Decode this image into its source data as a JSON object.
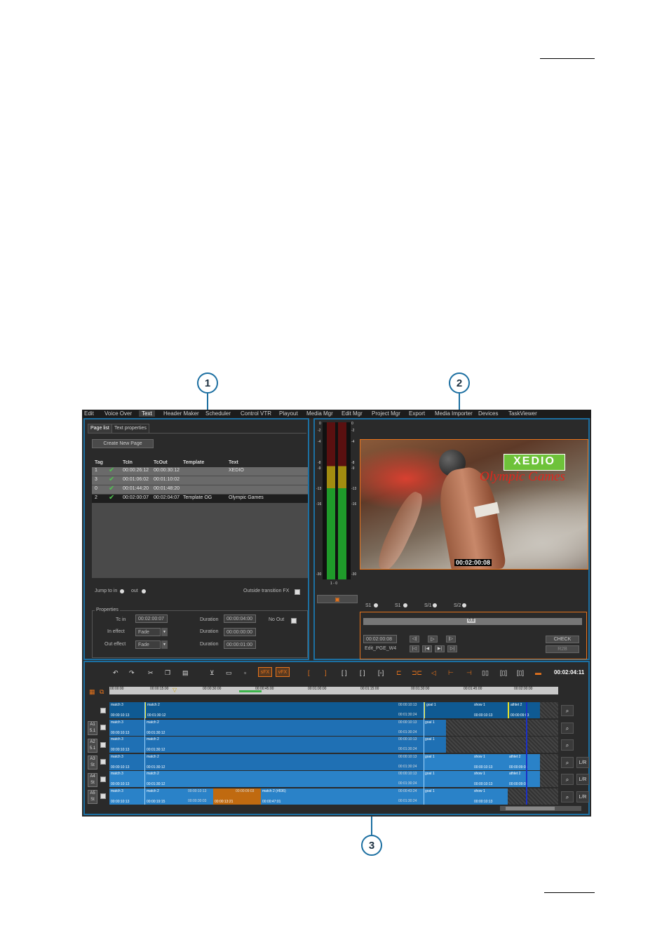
{
  "callouts": {
    "c1": "1",
    "c2": "2",
    "c3": "3"
  },
  "menu": [
    "Edit",
    "Voice Over",
    "Text",
    "Header Maker",
    "Scheduler",
    "Control VTR",
    "Playout",
    "Media Mgr",
    "Edit Mgr",
    "Project Mgr",
    "Export",
    "Media Importer",
    "Devices",
    "TaskViewer"
  ],
  "text_panel": {
    "tabs": [
      "Page list",
      "Text properties"
    ],
    "create_button": "Create New Page",
    "headers": [
      "Tag",
      "TcIn",
      "TcOut",
      "Template",
      "Text"
    ],
    "rows": [
      {
        "tag": "1",
        "tcin": "00:00:26:12",
        "tcout": "00:00:30:12",
        "template": "",
        "text": "XEDIO"
      },
      {
        "tag": "3",
        "tcin": "00:01:06:02",
        "tcout": "00:01:10:02",
        "template": "",
        "text": ""
      },
      {
        "tag": "0",
        "tcin": "00:01:44:20",
        "tcout": "00:01:48:20",
        "template": "",
        "text": ""
      },
      {
        "tag": "2",
        "tcin": "00:02:00:07",
        "tcout": "00:02:04:07",
        "template": "Template OG",
        "text": "Olympic Games"
      }
    ],
    "jump_to_in": "Jump to in",
    "out": "out",
    "outside_fx": "Outside transition FX",
    "properties": "Properties",
    "tc_in_label": "Tc in",
    "tc_in_value": "00:02:00:07",
    "duration_label": "Duration",
    "duration_values": [
      "00:00:04:00",
      "00:00:00:00",
      "00:00:01:00"
    ],
    "no_out": "No Out",
    "in_effect_label": "In effect",
    "out_effect_label": "Out effect",
    "in_effect_value": "Fade",
    "out_effect_value": "Fade"
  },
  "viewer": {
    "meter_scale_left": [
      "0",
      "-2",
      "-4",
      "-8",
      "-9",
      "-13",
      "-16",
      "-30"
    ],
    "meter_scale_right": [
      "0",
      "-2",
      "-4",
      "-8",
      "-9",
      "-13",
      "-16",
      "-30"
    ],
    "meter_channel": "1 - 0",
    "logo": "XEDIO",
    "overlay_text": "Olympic Games",
    "video_timecode": "00:02:00:08",
    "channels": [
      "S1",
      "S1",
      "S/1",
      "S/2"
    ],
    "transport_timecode": "00:02:00:08",
    "clip_name": "Edit_PGE_W4",
    "check": "CHECK",
    "r2b": "R2B",
    "progress_label": "0.0"
  },
  "timeline": {
    "total_timecode": "00:02:04:11",
    "ruler": [
      "00:00:00",
      "00:00:15:00",
      "00:00:30:00",
      "00:00:45:00",
      "00:01:00:00",
      "00:01:15:00",
      "00:01:30:00",
      "00:01:45:00",
      "00:02:00:00"
    ],
    "tracks": [
      {
        "label_top": "",
        "label_bottom": ""
      },
      {
        "label_top": "A1",
        "label_bottom": "5.1"
      },
      {
        "label_top": "A2",
        "label_bottom": "5.1"
      },
      {
        "label_top": "A3",
        "label_bottom": "St"
      },
      {
        "label_top": "A4",
        "label_bottom": "St"
      },
      {
        "label_top": "A5",
        "label_bottom": "St"
      }
    ],
    "clip_names": {
      "c1": "match 3",
      "c2": "match 2",
      "c3": "goal 1",
      "c4": "show 1",
      "c5": "athlet 2",
      "c6": "match 2 (#836)"
    },
    "clip_times": {
      "c1": "00:00:10:13",
      "c2": "00:01:30:12",
      "c3": "00:00:10:13",
      "c4": "00:01:30:24",
      "c5": "00:00:10:13",
      "c6": "00:00:09:03",
      "c7": "00:00:19:15",
      "c8": "00:00:30:03",
      "c9": "00:00:13:21",
      "c10": "00:00:47:01",
      "c11": "00:00:43:24"
    },
    "lr": "L/R",
    "sfx": "sFX",
    "vfx": "vFX"
  },
  "colors": {
    "panel_border": "#1c6fa1",
    "clip_blue": "#2a82c8",
    "clip_dark": "#0f5a93",
    "clip_orange": "#c06a10",
    "playhead": "#1a2fc7",
    "marker_yellow": "#e6e22a"
  }
}
